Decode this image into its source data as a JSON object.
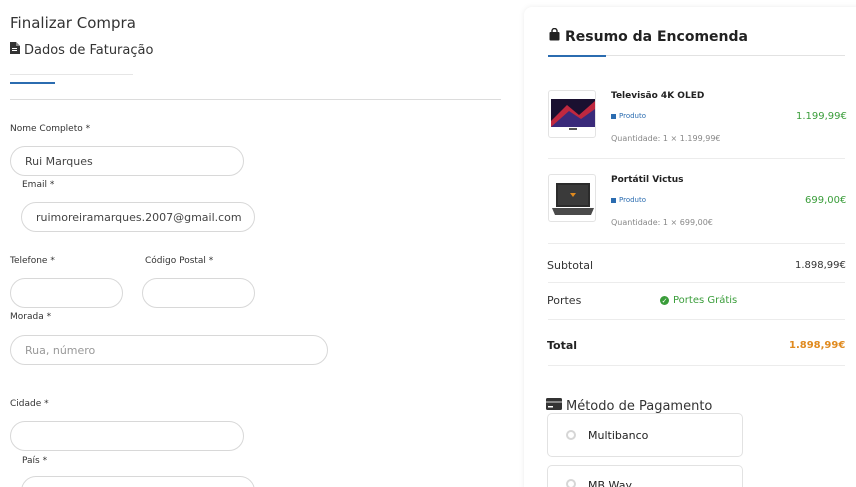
{
  "form": {
    "page_title": "Finalizar Compra",
    "section_title": "Dados de Faturação",
    "full_name_label": "Nome Completo *",
    "full_name_value": "Rui Marques",
    "email_label": "Email *",
    "email_value": "ruimoreiramarques.2007@gmail.com",
    "phone_label": "Telefone *",
    "phone_value": "",
    "postal_label": "Código Postal *",
    "postal_value": "",
    "address_label": "Morada *",
    "address_placeholder": "Rua, número",
    "city_label": "Cidade *",
    "city_value": "",
    "country_label": "País *"
  },
  "summary": {
    "title": "Resumo da Encomenda",
    "items": [
      {
        "name": "Televisão 4K OLED",
        "tag": "Produto",
        "quantity": "Quantidade: 1 × 1.199,99€",
        "price": "1.199,99€"
      },
      {
        "name": "Portátil Victus",
        "tag": "Produto",
        "quantity": "Quantidade: 1 × 699,00€",
        "price": "699,00€"
      }
    ],
    "subtotal_label": "Subtotal",
    "subtotal_value": "1.898,99€",
    "shipping_label": "Portes",
    "shipping_value": "Portes Grátis",
    "total_label": "Total",
    "total_value": "1.898,99€"
  },
  "payment": {
    "title": "Método de Pagamento",
    "options": [
      "Multibanco",
      "MB Way"
    ]
  },
  "colors": {
    "accent": "#2b6cb0",
    "price_green": "#3a9d3a",
    "total_orange": "#e08a1e"
  }
}
